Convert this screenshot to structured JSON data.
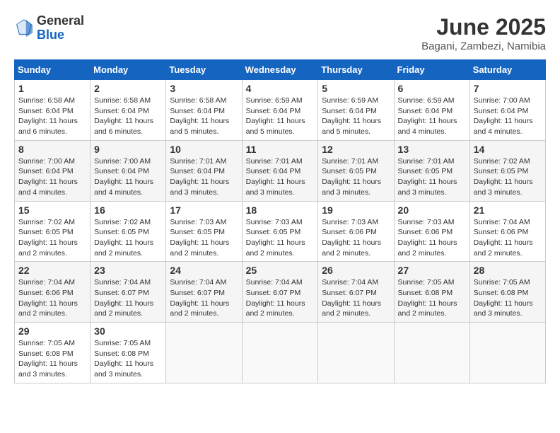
{
  "logo": {
    "general": "General",
    "blue": "Blue"
  },
  "header": {
    "title": "June 2025",
    "subtitle": "Bagani, Zambezi, Namibia"
  },
  "weekdays": [
    "Sunday",
    "Monday",
    "Tuesday",
    "Wednesday",
    "Thursday",
    "Friday",
    "Saturday"
  ],
  "weeks": [
    [
      {
        "day": "1",
        "sunrise": "6:58 AM",
        "sunset": "6:04 PM",
        "daylight": "11 hours and 6 minutes."
      },
      {
        "day": "2",
        "sunrise": "6:58 AM",
        "sunset": "6:04 PM",
        "daylight": "11 hours and 6 minutes."
      },
      {
        "day": "3",
        "sunrise": "6:58 AM",
        "sunset": "6:04 PM",
        "daylight": "11 hours and 5 minutes."
      },
      {
        "day": "4",
        "sunrise": "6:59 AM",
        "sunset": "6:04 PM",
        "daylight": "11 hours and 5 minutes."
      },
      {
        "day": "5",
        "sunrise": "6:59 AM",
        "sunset": "6:04 PM",
        "daylight": "11 hours and 5 minutes."
      },
      {
        "day": "6",
        "sunrise": "6:59 AM",
        "sunset": "6:04 PM",
        "daylight": "11 hours and 4 minutes."
      },
      {
        "day": "7",
        "sunrise": "7:00 AM",
        "sunset": "6:04 PM",
        "daylight": "11 hours and 4 minutes."
      }
    ],
    [
      {
        "day": "8",
        "sunrise": "7:00 AM",
        "sunset": "6:04 PM",
        "daylight": "11 hours and 4 minutes."
      },
      {
        "day": "9",
        "sunrise": "7:00 AM",
        "sunset": "6:04 PM",
        "daylight": "11 hours and 4 minutes."
      },
      {
        "day": "10",
        "sunrise": "7:01 AM",
        "sunset": "6:04 PM",
        "daylight": "11 hours and 3 minutes."
      },
      {
        "day": "11",
        "sunrise": "7:01 AM",
        "sunset": "6:04 PM",
        "daylight": "11 hours and 3 minutes."
      },
      {
        "day": "12",
        "sunrise": "7:01 AM",
        "sunset": "6:05 PM",
        "daylight": "11 hours and 3 minutes."
      },
      {
        "day": "13",
        "sunrise": "7:01 AM",
        "sunset": "6:05 PM",
        "daylight": "11 hours and 3 minutes."
      },
      {
        "day": "14",
        "sunrise": "7:02 AM",
        "sunset": "6:05 PM",
        "daylight": "11 hours and 3 minutes."
      }
    ],
    [
      {
        "day": "15",
        "sunrise": "7:02 AM",
        "sunset": "6:05 PM",
        "daylight": "11 hours and 2 minutes."
      },
      {
        "day": "16",
        "sunrise": "7:02 AM",
        "sunset": "6:05 PM",
        "daylight": "11 hours and 2 minutes."
      },
      {
        "day": "17",
        "sunrise": "7:03 AM",
        "sunset": "6:05 PM",
        "daylight": "11 hours and 2 minutes."
      },
      {
        "day": "18",
        "sunrise": "7:03 AM",
        "sunset": "6:05 PM",
        "daylight": "11 hours and 2 minutes."
      },
      {
        "day": "19",
        "sunrise": "7:03 AM",
        "sunset": "6:06 PM",
        "daylight": "11 hours and 2 minutes."
      },
      {
        "day": "20",
        "sunrise": "7:03 AM",
        "sunset": "6:06 PM",
        "daylight": "11 hours and 2 minutes."
      },
      {
        "day": "21",
        "sunrise": "7:04 AM",
        "sunset": "6:06 PM",
        "daylight": "11 hours and 2 minutes."
      }
    ],
    [
      {
        "day": "22",
        "sunrise": "7:04 AM",
        "sunset": "6:06 PM",
        "daylight": "11 hours and 2 minutes."
      },
      {
        "day": "23",
        "sunrise": "7:04 AM",
        "sunset": "6:07 PM",
        "daylight": "11 hours and 2 minutes."
      },
      {
        "day": "24",
        "sunrise": "7:04 AM",
        "sunset": "6:07 PM",
        "daylight": "11 hours and 2 minutes."
      },
      {
        "day": "25",
        "sunrise": "7:04 AM",
        "sunset": "6:07 PM",
        "daylight": "11 hours and 2 minutes."
      },
      {
        "day": "26",
        "sunrise": "7:04 AM",
        "sunset": "6:07 PM",
        "daylight": "11 hours and 2 minutes."
      },
      {
        "day": "27",
        "sunrise": "7:05 AM",
        "sunset": "6:08 PM",
        "daylight": "11 hours and 2 minutes."
      },
      {
        "day": "28",
        "sunrise": "7:05 AM",
        "sunset": "6:08 PM",
        "daylight": "11 hours and 3 minutes."
      }
    ],
    [
      {
        "day": "29",
        "sunrise": "7:05 AM",
        "sunset": "6:08 PM",
        "daylight": "11 hours and 3 minutes."
      },
      {
        "day": "30",
        "sunrise": "7:05 AM",
        "sunset": "6:08 PM",
        "daylight": "11 hours and 3 minutes."
      },
      null,
      null,
      null,
      null,
      null
    ]
  ],
  "labels": {
    "sunrise": "Sunrise:",
    "sunset": "Sunset:",
    "daylight": "Daylight hours"
  }
}
